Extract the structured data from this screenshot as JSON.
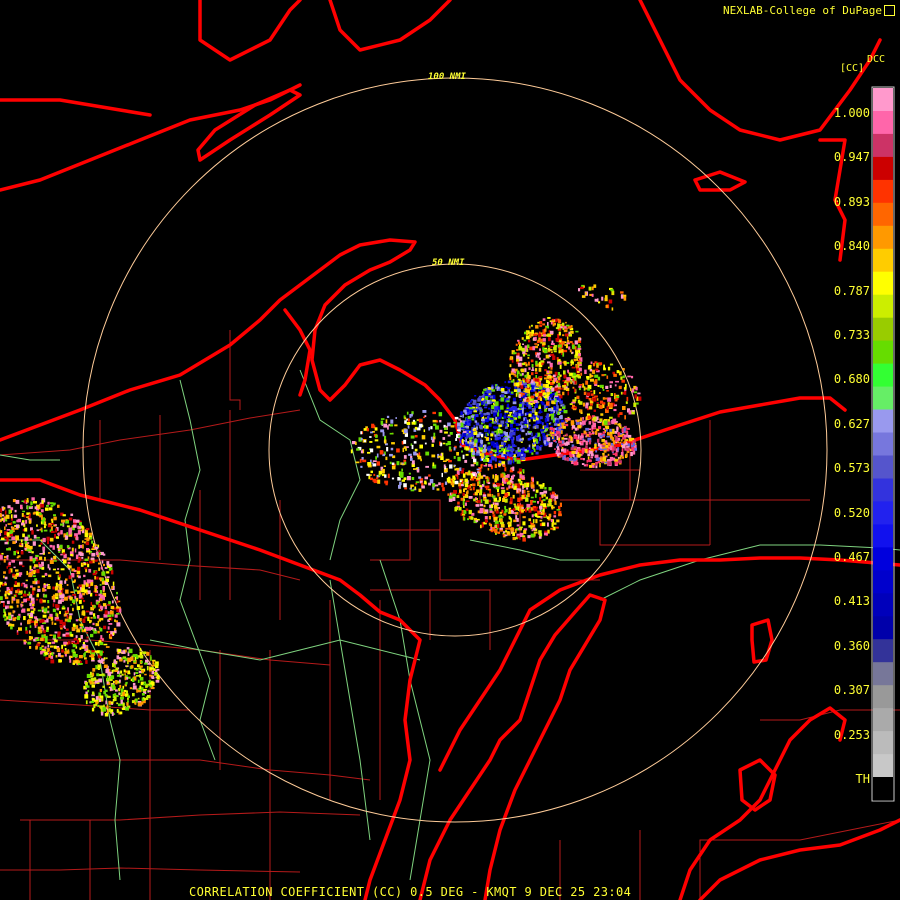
{
  "header": {
    "credit": "NEXLAB-College of DuPage"
  },
  "footer": {
    "caption": "CORRELATION COEFFICIENT (CC) 0.5 DEG - KMQT 9 DEC 25 23:04"
  },
  "range_rings": [
    {
      "label": "100 NMI"
    },
    {
      "label": "50 NMI"
    }
  ],
  "colorbar": {
    "product": "DCC",
    "unit": "[CC]",
    "ticks": [
      "1.000",
      "0.947",
      "0.893",
      "0.840",
      "0.787",
      "0.733",
      "0.680",
      "0.627",
      "0.573",
      "0.520",
      "0.467",
      "0.413",
      "0.360",
      "0.307",
      "0.253",
      "TH"
    ],
    "colors": [
      "#ff99cc",
      "#ff66aa",
      "#cc3366",
      "#cc0000",
      "#ff3300",
      "#ff6600",
      "#ff9900",
      "#ffcc00",
      "#ffff00",
      "#ccee00",
      "#99cc00",
      "#66dd00",
      "#33ff33",
      "#66ee66",
      "#9999ee",
      "#7777dd",
      "#5555cc",
      "#3333dd",
      "#2222ee",
      "#1111ee",
      "#0000dd",
      "#0000cc",
      "#0000bb",
      "#0000aa",
      "#333399",
      "#777799",
      "#999999",
      "#aaaaaa",
      "#bbbbbb",
      "#c8c8c8",
      "#000000"
    ]
  },
  "colors": {
    "state_border": "#ff0000",
    "county_border": "#cc2222",
    "rivers": "#88dd88",
    "rings": "#ffcc99",
    "text": "#ffff33"
  }
}
